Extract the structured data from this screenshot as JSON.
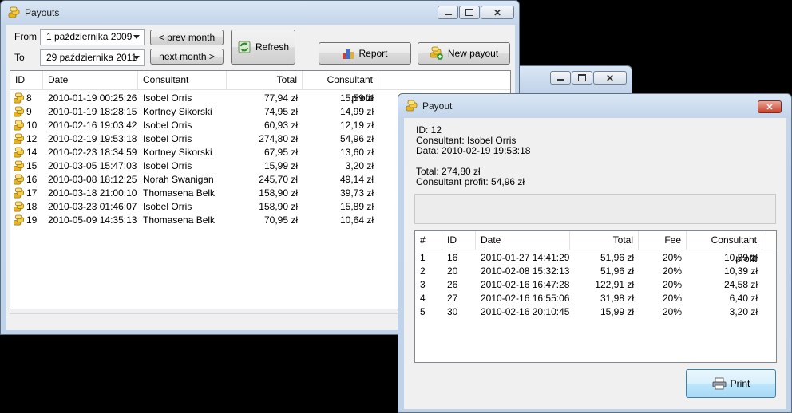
{
  "payouts_window": {
    "title": "Payouts",
    "from_label": "From",
    "to_label": "To",
    "from_value": "1 października 2009",
    "to_value": "29 października 2011",
    "prev_month": "< prev month",
    "next_month": "next month >",
    "refresh": "Refresh",
    "report": "Report",
    "new_payout": "New payout",
    "columns": [
      "ID",
      "Date",
      "Consultant",
      "Total",
      "Consultant profit"
    ],
    "rows": [
      {
        "id": "8",
        "date": "2010-01-19 00:25:26",
        "consultant": "Isobel Orris",
        "total": "77,94 zł",
        "profit": "15,59 zł"
      },
      {
        "id": "9",
        "date": "2010-01-19 18:28:15",
        "consultant": "Kortney Sikorski",
        "total": "74,95 zł",
        "profit": "14,99 zł"
      },
      {
        "id": "10",
        "date": "2010-02-16 19:03:42",
        "consultant": "Isobel Orris",
        "total": "60,93 zł",
        "profit": "12,19 zł"
      },
      {
        "id": "12",
        "date": "2010-02-19 19:53:18",
        "consultant": "Isobel Orris",
        "total": "274,80 zł",
        "profit": "54,96 zł"
      },
      {
        "id": "14",
        "date": "2010-02-23 18:34:59",
        "consultant": "Kortney Sikorski",
        "total": "67,95 zł",
        "profit": "13,60 zł"
      },
      {
        "id": "15",
        "date": "2010-03-05 15:47:03",
        "consultant": "Isobel Orris",
        "total": "15,99 zł",
        "profit": "3,20 zł"
      },
      {
        "id": "16",
        "date": "2010-03-08 18:12:25",
        "consultant": "Norah Swanigan",
        "total": "245,70 zł",
        "profit": "49,14 zł"
      },
      {
        "id": "17",
        "date": "2010-03-18 21:00:10",
        "consultant": "Thomasena Belk",
        "total": "158,90 zł",
        "profit": "39,73 zł"
      },
      {
        "id": "18",
        "date": "2010-03-23 01:46:07",
        "consultant": "Isobel Orris",
        "total": "158,90 zł",
        "profit": "15,89 zł"
      },
      {
        "id": "19",
        "date": "2010-05-09 14:35:13",
        "consultant": "Thomasena Belk",
        "total": "70,95 zł",
        "profit": "10,64 zł"
      }
    ]
  },
  "payout_window": {
    "title": "Payout",
    "id_line": "ID: 12",
    "consultant_line": "Consultant: Isobel Orris",
    "data_line": "Data: 2010-02-19 19:53:18",
    "total_line": "Total: 274,80 zł",
    "profit_line": "Consultant profit: 54,96 zł",
    "columns": [
      "#",
      "ID",
      "Date",
      "Total",
      "Fee",
      "Consultant profit"
    ],
    "rows": [
      {
        "n": "1",
        "id": "16",
        "date": "2010-01-27 14:41:29",
        "total": "51,96 zł",
        "fee": "20%",
        "profit": "10,39 zł"
      },
      {
        "n": "2",
        "id": "20",
        "date": "2010-02-08 15:32:13",
        "total": "51,96 zł",
        "fee": "20%",
        "profit": "10,39 zł"
      },
      {
        "n": "3",
        "id": "26",
        "date": "2010-02-16 16:47:28",
        "total": "122,91 zł",
        "fee": "20%",
        "profit": "24,58 zł"
      },
      {
        "n": "4",
        "id": "27",
        "date": "2010-02-16 16:55:06",
        "total": "31,98 zł",
        "fee": "20%",
        "profit": "6,40 zł"
      },
      {
        "n": "5",
        "id": "30",
        "date": "2010-02-16 20:10:45",
        "total": "15,99 zł",
        "fee": "20%",
        "profit": "3,20 zł"
      }
    ],
    "print": "Print"
  },
  "icons": {
    "app": "coins-icon",
    "refresh": "refresh-icon",
    "report": "bar-chart-icon",
    "new_payout": "coins-add-icon",
    "print": "printer-icon"
  }
}
